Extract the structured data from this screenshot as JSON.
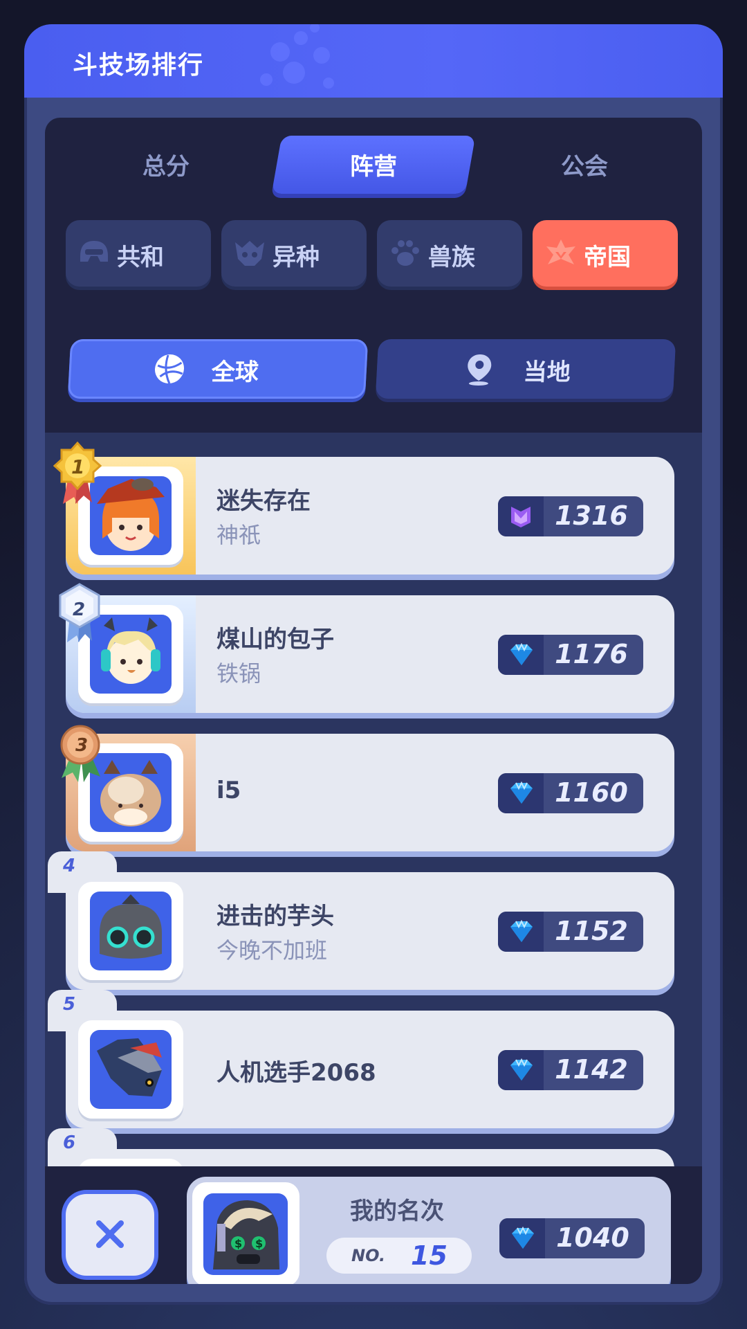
{
  "panel": {
    "title": "斗技场排行"
  },
  "tabs": [
    {
      "label": "总分",
      "active": false
    },
    {
      "label": "阵营",
      "active": true
    },
    {
      "label": "公会",
      "active": false
    }
  ],
  "factions": [
    {
      "label": "共和",
      "icon": "helmet-icon",
      "active": false
    },
    {
      "label": "异种",
      "icon": "beast-mask-icon",
      "active": false
    },
    {
      "label": "兽族",
      "icon": "paw-icon",
      "active": false
    },
    {
      "label": "帝国",
      "icon": "empire-crest-icon",
      "active": true
    }
  ],
  "scope": {
    "global": {
      "label": "全球",
      "icon": "globe-icon",
      "active": true
    },
    "local": {
      "label": "当地",
      "icon": "location-pin-icon",
      "active": false
    }
  },
  "leaderboard": [
    {
      "rank": "1",
      "name": "迷失存在",
      "subtitle": "神祇",
      "score": "1316",
      "score_icon": "purple-crest-icon"
    },
    {
      "rank": "2",
      "name": "煤山的包子",
      "subtitle": "铁锅",
      "score": "1176",
      "score_icon": "diamond-icon"
    },
    {
      "rank": "3",
      "name": "i5",
      "subtitle": "",
      "score": "1160",
      "score_icon": "diamond-icon"
    },
    {
      "rank": "4",
      "name": "进击的芋头",
      "subtitle": "今晚不加班",
      "score": "1152",
      "score_icon": "diamond-icon"
    },
    {
      "rank": "5",
      "name": "人机选手2068",
      "subtitle": "",
      "score": "1142",
      "score_icon": "diamond-icon"
    },
    {
      "rank": "6",
      "name": "",
      "subtitle": "",
      "score": "",
      "score_icon": "diamond-icon"
    }
  ],
  "my_rank": {
    "title": "我的名次",
    "no_label": "NO.",
    "position": "15",
    "score": "1040"
  },
  "colors": {
    "accent": "#4f6df0",
    "active_faction": "#ff6f5e",
    "row_bg": "#e6e9f2"
  }
}
